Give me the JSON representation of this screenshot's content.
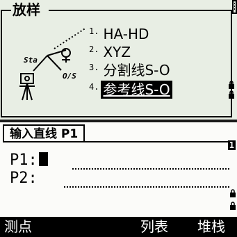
{
  "top": {
    "title": "放样",
    "menu": [
      {
        "num": "1.",
        "label": "HA-HD"
      },
      {
        "num": "2.",
        "label": "XYZ"
      },
      {
        "num": "3.",
        "label": "分割线S-O"
      },
      {
        "num": "4.",
        "label": "参考线S-O",
        "selected": true
      }
    ],
    "diagram": {
      "sta_label": "Sta",
      "os_label": "O/S"
    }
  },
  "bottom": {
    "tab_title": "输入直线 P1",
    "fields": [
      {
        "label": "P1:",
        "value": ""
      },
      {
        "label": "P2:",
        "value": ""
      }
    ],
    "side_indicator": "1",
    "softkeys": {
      "left": "测点",
      "mid": "列表",
      "right": "堆栈"
    }
  }
}
